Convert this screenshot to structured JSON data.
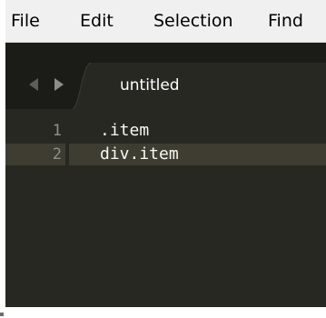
{
  "menubar": {
    "items": [
      "File",
      "Edit",
      "Selection",
      "Find"
    ]
  },
  "tabbar": {
    "active_tab": "untitled"
  },
  "editor": {
    "lines": [
      {
        "number": "1",
        "text": ".item"
      },
      {
        "number": "2",
        "text": "div.item"
      }
    ],
    "current_line": 2
  },
  "colors": {
    "editor_bg": "#272822",
    "tabbar_bg": "#1b1c17",
    "current_line_bg": "#3e3d32",
    "text": "#f8f8f2",
    "line_number": "#8f908a",
    "menubar_bg": "#f0f0f0"
  },
  "icons": [
    "tab-nav-left-arrow-icon",
    "tab-nav-right-arrow-icon"
  ]
}
